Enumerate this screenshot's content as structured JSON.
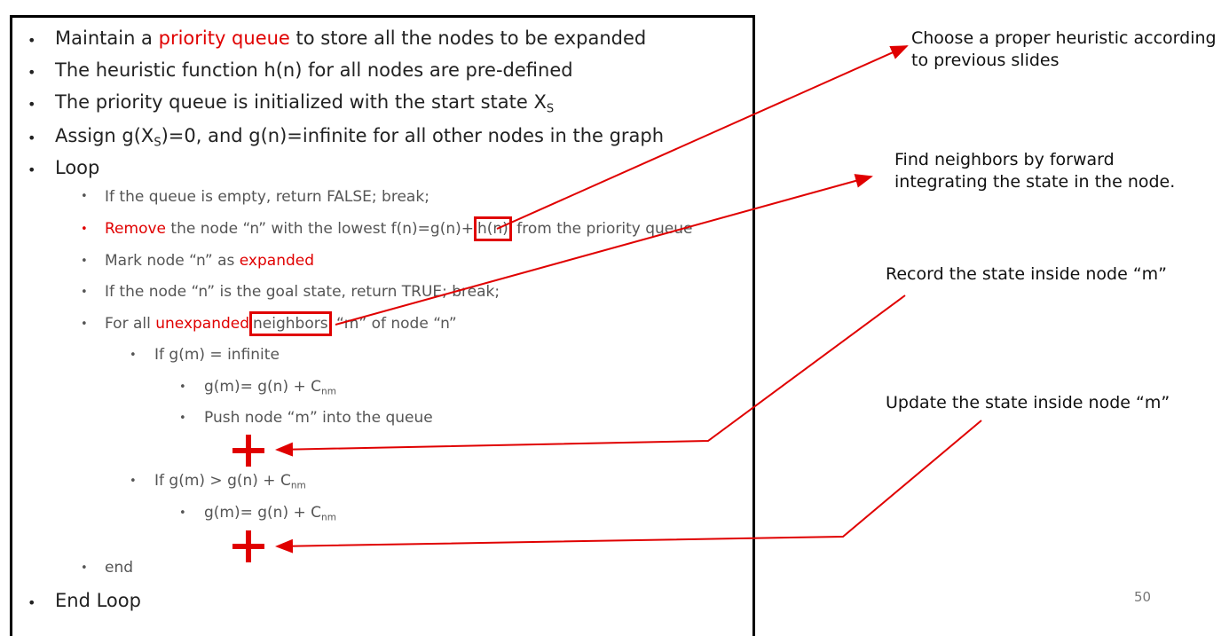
{
  "bullets": {
    "b1": {
      "pre": "Maintain a ",
      "highlight": "priority queue",
      "post": " to store all the nodes to be expanded"
    },
    "b2": "The heuristic function h(n) for all nodes are pre-defined",
    "b3": {
      "text": "The priority queue is initialized with the start state X",
      "sub": "S"
    },
    "b4": {
      "pre": "Assign g(X",
      "sub": "S",
      "post": ")=0, and g(n)=infinite for all other nodes in the graph"
    },
    "b5": "Loop",
    "b6": "If the queue is empty, return FALSE; break;",
    "b7": {
      "red": "Remove",
      "pre": " the node “n” with the lowest f(n)=g(n)+",
      "box": "h(n)",
      "post": " from the priority queue"
    },
    "b8": {
      "pre": "Mark node “n” as ",
      "red": "expanded"
    },
    "b9": "If the node “n” is the goal state, return TRUE; break;",
    "b10": {
      "pre": "For all ",
      "red": "unexpanded",
      "box": "neighbors",
      "post": " “m” of node “n”"
    },
    "b11": "If g(m) = infinite",
    "b12": {
      "text": "g(m)= g(n) + C",
      "sub": "nm"
    },
    "b13": "Push node “m” into the queue",
    "b14": {
      "text": "If g(m) > g(n) + C",
      "sub": "nm"
    },
    "b15": {
      "text": "g(m)= g(n) + C",
      "sub": "nm"
    },
    "b16": "end",
    "b17": "End Loop"
  },
  "bullet_glyphs": {
    "level1": "•",
    "level2": "•",
    "level3": "•",
    "level4": "•"
  },
  "annotations": {
    "heuristic": {
      "line1": "Choose a proper heuristic according",
      "line2": "to previous slides"
    },
    "neighbors": {
      "line1": "Find neighbors by forward",
      "line2": "integrating the state in the node."
    },
    "record": "Record the state inside node “m”",
    "update": "Update the state inside node “m”"
  },
  "page_number": "50",
  "colors": {
    "accent": "#e00000",
    "text": "#222222",
    "subtext": "#555555"
  }
}
